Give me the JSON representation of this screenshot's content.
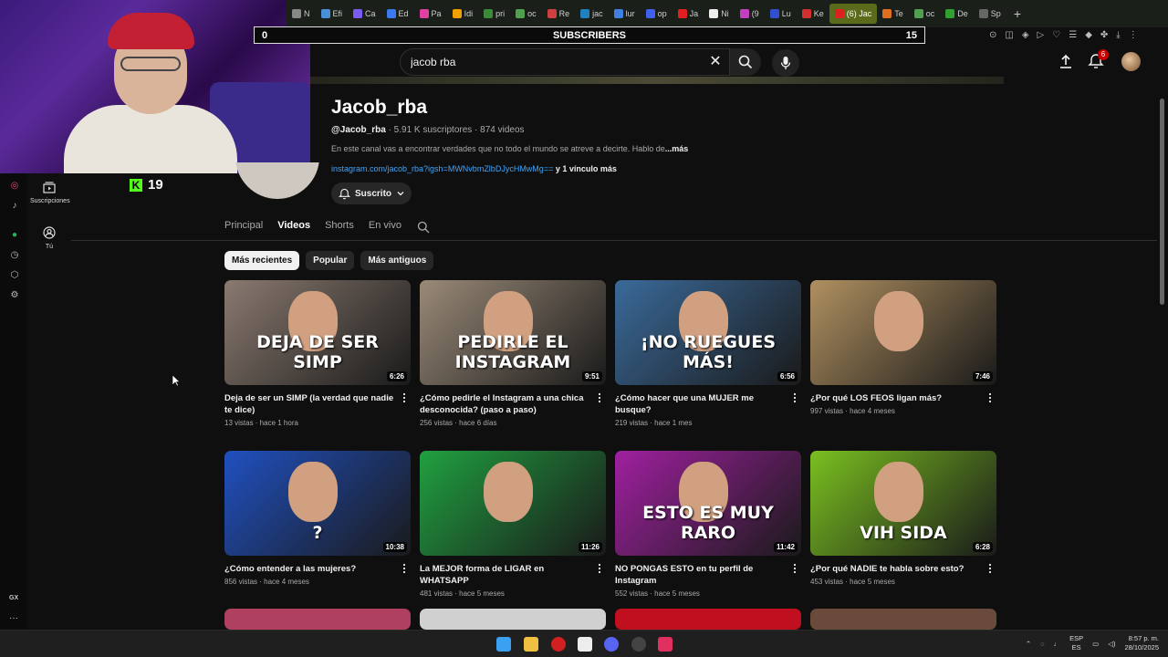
{
  "browser": {
    "tabs": [
      {
        "label": "N",
        "color": "#888"
      },
      {
        "label": "Efi",
        "color": "#4a90d9"
      },
      {
        "label": "Ca",
        "color": "#7b5cf0"
      },
      {
        "label": "Ed",
        "color": "#3a7af0"
      },
      {
        "label": "Pa",
        "color": "#e040a0"
      },
      {
        "label": "Idi",
        "color": "#f0a000"
      },
      {
        "label": "pri",
        "color": "#3a8a3a"
      },
      {
        "label": "oc",
        "color": "#50a050"
      },
      {
        "label": "Re",
        "color": "#d04040"
      },
      {
        "label": "jac",
        "color": "#2080c0"
      },
      {
        "label": "lur",
        "color": "#4080e0"
      },
      {
        "label": "op",
        "color": "#4060f0"
      },
      {
        "label": "Ja",
        "color": "#e02020"
      },
      {
        "label": "Ni",
        "color": "#eee"
      },
      {
        "label": "(9",
        "color": "#c040c0"
      },
      {
        "label": "Lu",
        "color": "#3050d0"
      },
      {
        "label": "Ke",
        "color": "#d03030"
      },
      {
        "label": "(6) Jac",
        "color": "#e02020",
        "active": true
      },
      {
        "label": "Te",
        "color": "#e07020"
      },
      {
        "label": "oc",
        "color": "#50a050"
      },
      {
        "label": "De",
        "color": "#30a030"
      },
      {
        "label": "Sp",
        "color": "#666"
      }
    ],
    "new_tab": "+"
  },
  "overlay": {
    "sub_start": "0",
    "sub_label": "SUBSCRIBERS",
    "sub_goal": "15",
    "kick_label": "K",
    "kick_count": "19"
  },
  "youtube": {
    "search_value": "jacob rba",
    "notif_count": "6",
    "guide": [
      {
        "name": "subscriptions",
        "label": "Suscripciones",
        "icon": "subscriptions-icon"
      },
      {
        "name": "you",
        "label": "Tú",
        "icon": "user-icon"
      }
    ]
  },
  "channel": {
    "name": "Jacob_rba",
    "handle": "@Jacob_rba",
    "stats": "· 5.91 K suscriptores · 874 videos",
    "description": "En este canal vas a encontrar verdades que no todo el mundo se atreve a decirte. Hablo de",
    "more": "...más",
    "link": "instagram.com/jacob_rba?igsh=MWNvbmZlbDJycHMwMg==",
    "link_extra": " y 1 vínculo más",
    "subscribe_label": "Suscrito",
    "tabs": [
      "Principal",
      "Videos",
      "Shorts",
      "En vivo"
    ],
    "active_tab": "Videos",
    "chips": [
      "Más recientes",
      "Popular",
      "Más antiguos"
    ]
  },
  "videos": [
    {
      "title": "Deja de ser un SIMP (la verdad que nadie te dice)",
      "meta": "13 vistas · hace 1 hora",
      "duration": "6:26",
      "thumb_text": "DEJA DE SER SIMP",
      "bg": "#8a7a70"
    },
    {
      "title": "¿Cómo pedirle el Instagram a una chica desconocida? (paso a paso)",
      "meta": "256 vistas · hace 6 días",
      "duration": "9:51",
      "thumb_text": "PEDIRLE EL INSTAGRAM",
      "bg": "#9a8a78"
    },
    {
      "title": "¿Cómo hacer que una MUJER me busque?",
      "meta": "219 vistas · hace 1 mes",
      "duration": "6:56",
      "thumb_text": "¡NO RUEGUES MÁS!",
      "bg": "#3a6a9a"
    },
    {
      "title": "¿Por qué LOS FEOS ligan más?",
      "meta": "997 vistas · hace 4 meses",
      "duration": "7:46",
      "thumb_text": "",
      "bg": "#b09060"
    },
    {
      "title": "¿Cómo entender a las mujeres?",
      "meta": "856 vistas · hace 4 meses",
      "duration": "10:38",
      "thumb_text": "?",
      "bg": "#2050c0"
    },
    {
      "title": "La MEJOR forma de LIGAR en WHATSAPP",
      "meta": "481 vistas · hace 5 meses",
      "duration": "11:26",
      "thumb_text": "",
      "bg": "#20a040"
    },
    {
      "title": "NO PONGAS ESTO en tu perfil de Instagram",
      "meta": "552 vistas · hace 5 meses",
      "duration": "11:42",
      "thumb_text": "ESTO ES MUY RARO",
      "bg": "#a020a0"
    },
    {
      "title": "¿Por qué NADIE te habla sobre esto?",
      "meta": "453 vistas · hace 5 meses",
      "duration": "6:28",
      "thumb_text": "VIH SIDA",
      "bg": "#7ac020"
    }
  ],
  "taskbar": {
    "lang_top": "ESP",
    "lang_bottom": "ES",
    "time": "8:57 p. m.",
    "date": "28/10/2025"
  },
  "sidebar_bottom": {
    "gx_label": "GX",
    "more": "···"
  }
}
